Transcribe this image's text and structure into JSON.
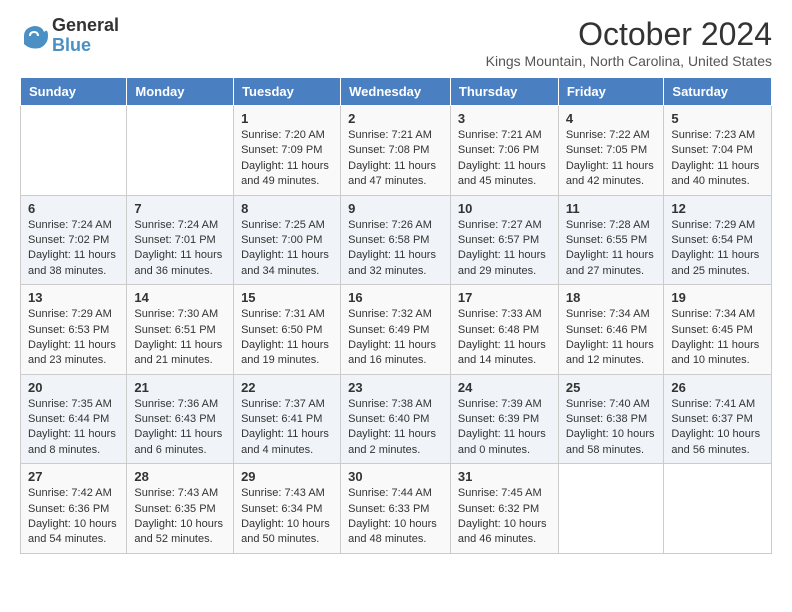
{
  "logo": {
    "line1": "General",
    "line2": "Blue"
  },
  "title": "October 2024",
  "subtitle": "Kings Mountain, North Carolina, United States",
  "days_of_week": [
    "Sunday",
    "Monday",
    "Tuesday",
    "Wednesday",
    "Thursday",
    "Friday",
    "Saturday"
  ],
  "weeks": [
    [
      {
        "day": "",
        "sunrise": "",
        "sunset": "",
        "daylight": ""
      },
      {
        "day": "",
        "sunrise": "",
        "sunset": "",
        "daylight": ""
      },
      {
        "day": "1",
        "sunrise": "Sunrise: 7:20 AM",
        "sunset": "Sunset: 7:09 PM",
        "daylight": "Daylight: 11 hours and 49 minutes."
      },
      {
        "day": "2",
        "sunrise": "Sunrise: 7:21 AM",
        "sunset": "Sunset: 7:08 PM",
        "daylight": "Daylight: 11 hours and 47 minutes."
      },
      {
        "day": "3",
        "sunrise": "Sunrise: 7:21 AM",
        "sunset": "Sunset: 7:06 PM",
        "daylight": "Daylight: 11 hours and 45 minutes."
      },
      {
        "day": "4",
        "sunrise": "Sunrise: 7:22 AM",
        "sunset": "Sunset: 7:05 PM",
        "daylight": "Daylight: 11 hours and 42 minutes."
      },
      {
        "day": "5",
        "sunrise": "Sunrise: 7:23 AM",
        "sunset": "Sunset: 7:04 PM",
        "daylight": "Daylight: 11 hours and 40 minutes."
      }
    ],
    [
      {
        "day": "6",
        "sunrise": "Sunrise: 7:24 AM",
        "sunset": "Sunset: 7:02 PM",
        "daylight": "Daylight: 11 hours and 38 minutes."
      },
      {
        "day": "7",
        "sunrise": "Sunrise: 7:24 AM",
        "sunset": "Sunset: 7:01 PM",
        "daylight": "Daylight: 11 hours and 36 minutes."
      },
      {
        "day": "8",
        "sunrise": "Sunrise: 7:25 AM",
        "sunset": "Sunset: 7:00 PM",
        "daylight": "Daylight: 11 hours and 34 minutes."
      },
      {
        "day": "9",
        "sunrise": "Sunrise: 7:26 AM",
        "sunset": "Sunset: 6:58 PM",
        "daylight": "Daylight: 11 hours and 32 minutes."
      },
      {
        "day": "10",
        "sunrise": "Sunrise: 7:27 AM",
        "sunset": "Sunset: 6:57 PM",
        "daylight": "Daylight: 11 hours and 29 minutes."
      },
      {
        "day": "11",
        "sunrise": "Sunrise: 7:28 AM",
        "sunset": "Sunset: 6:55 PM",
        "daylight": "Daylight: 11 hours and 27 minutes."
      },
      {
        "day": "12",
        "sunrise": "Sunrise: 7:29 AM",
        "sunset": "Sunset: 6:54 PM",
        "daylight": "Daylight: 11 hours and 25 minutes."
      }
    ],
    [
      {
        "day": "13",
        "sunrise": "Sunrise: 7:29 AM",
        "sunset": "Sunset: 6:53 PM",
        "daylight": "Daylight: 11 hours and 23 minutes."
      },
      {
        "day": "14",
        "sunrise": "Sunrise: 7:30 AM",
        "sunset": "Sunset: 6:51 PM",
        "daylight": "Daylight: 11 hours and 21 minutes."
      },
      {
        "day": "15",
        "sunrise": "Sunrise: 7:31 AM",
        "sunset": "Sunset: 6:50 PM",
        "daylight": "Daylight: 11 hours and 19 minutes."
      },
      {
        "day": "16",
        "sunrise": "Sunrise: 7:32 AM",
        "sunset": "Sunset: 6:49 PM",
        "daylight": "Daylight: 11 hours and 16 minutes."
      },
      {
        "day": "17",
        "sunrise": "Sunrise: 7:33 AM",
        "sunset": "Sunset: 6:48 PM",
        "daylight": "Daylight: 11 hours and 14 minutes."
      },
      {
        "day": "18",
        "sunrise": "Sunrise: 7:34 AM",
        "sunset": "Sunset: 6:46 PM",
        "daylight": "Daylight: 11 hours and 12 minutes."
      },
      {
        "day": "19",
        "sunrise": "Sunrise: 7:34 AM",
        "sunset": "Sunset: 6:45 PM",
        "daylight": "Daylight: 11 hours and 10 minutes."
      }
    ],
    [
      {
        "day": "20",
        "sunrise": "Sunrise: 7:35 AM",
        "sunset": "Sunset: 6:44 PM",
        "daylight": "Daylight: 11 hours and 8 minutes."
      },
      {
        "day": "21",
        "sunrise": "Sunrise: 7:36 AM",
        "sunset": "Sunset: 6:43 PM",
        "daylight": "Daylight: 11 hours and 6 minutes."
      },
      {
        "day": "22",
        "sunrise": "Sunrise: 7:37 AM",
        "sunset": "Sunset: 6:41 PM",
        "daylight": "Daylight: 11 hours and 4 minutes."
      },
      {
        "day": "23",
        "sunrise": "Sunrise: 7:38 AM",
        "sunset": "Sunset: 6:40 PM",
        "daylight": "Daylight: 11 hours and 2 minutes."
      },
      {
        "day": "24",
        "sunrise": "Sunrise: 7:39 AM",
        "sunset": "Sunset: 6:39 PM",
        "daylight": "Daylight: 11 hours and 0 minutes."
      },
      {
        "day": "25",
        "sunrise": "Sunrise: 7:40 AM",
        "sunset": "Sunset: 6:38 PM",
        "daylight": "Daylight: 10 hours and 58 minutes."
      },
      {
        "day": "26",
        "sunrise": "Sunrise: 7:41 AM",
        "sunset": "Sunset: 6:37 PM",
        "daylight": "Daylight: 10 hours and 56 minutes."
      }
    ],
    [
      {
        "day": "27",
        "sunrise": "Sunrise: 7:42 AM",
        "sunset": "Sunset: 6:36 PM",
        "daylight": "Daylight: 10 hours and 54 minutes."
      },
      {
        "day": "28",
        "sunrise": "Sunrise: 7:43 AM",
        "sunset": "Sunset: 6:35 PM",
        "daylight": "Daylight: 10 hours and 52 minutes."
      },
      {
        "day": "29",
        "sunrise": "Sunrise: 7:43 AM",
        "sunset": "Sunset: 6:34 PM",
        "daylight": "Daylight: 10 hours and 50 minutes."
      },
      {
        "day": "30",
        "sunrise": "Sunrise: 7:44 AM",
        "sunset": "Sunset: 6:33 PM",
        "daylight": "Daylight: 10 hours and 48 minutes."
      },
      {
        "day": "31",
        "sunrise": "Sunrise: 7:45 AM",
        "sunset": "Sunset: 6:32 PM",
        "daylight": "Daylight: 10 hours and 46 minutes."
      },
      {
        "day": "",
        "sunrise": "",
        "sunset": "",
        "daylight": ""
      },
      {
        "day": "",
        "sunrise": "",
        "sunset": "",
        "daylight": ""
      }
    ]
  ]
}
